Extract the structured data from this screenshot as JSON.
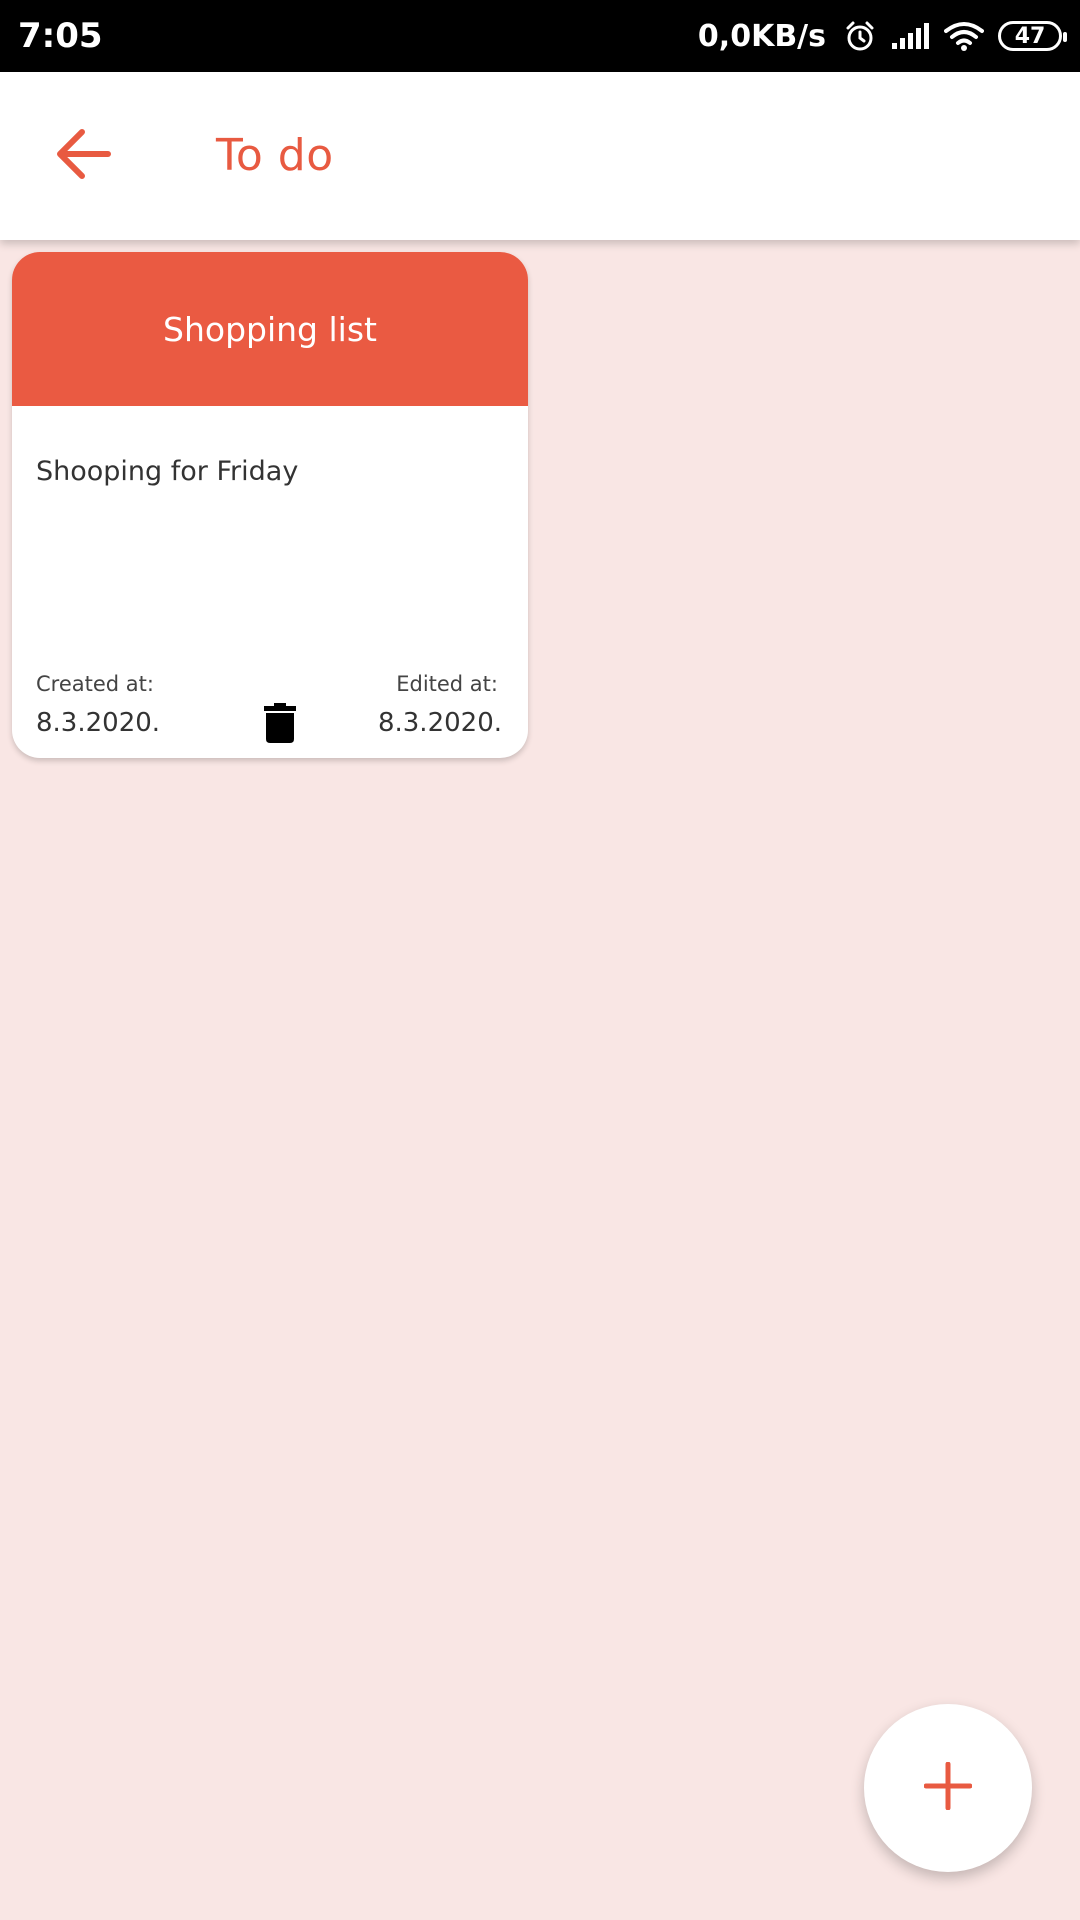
{
  "status_bar": {
    "time": "7:05",
    "net_speed": "0,0KB/s",
    "battery": "47",
    "icons": [
      "alarm-icon",
      "signal-icon",
      "wifi-icon",
      "battery-icon"
    ]
  },
  "app_bar": {
    "title": "To do",
    "back_icon": "arrow-left-icon"
  },
  "notes": [
    {
      "title": "Shopping list",
      "body": "Shooping for Friday",
      "created_label": "Created at:",
      "created_date": "8.3.2020.",
      "edited_label": "Edited at:",
      "edited_date": "8.3.2020.",
      "delete_icon": "trash-icon"
    }
  ],
  "fab": {
    "icon": "plus-icon"
  },
  "colors": {
    "accent": "#ea5a42",
    "background": "#f9e6e4",
    "app_bar": "#ffffff",
    "status_bar": "#000000"
  }
}
